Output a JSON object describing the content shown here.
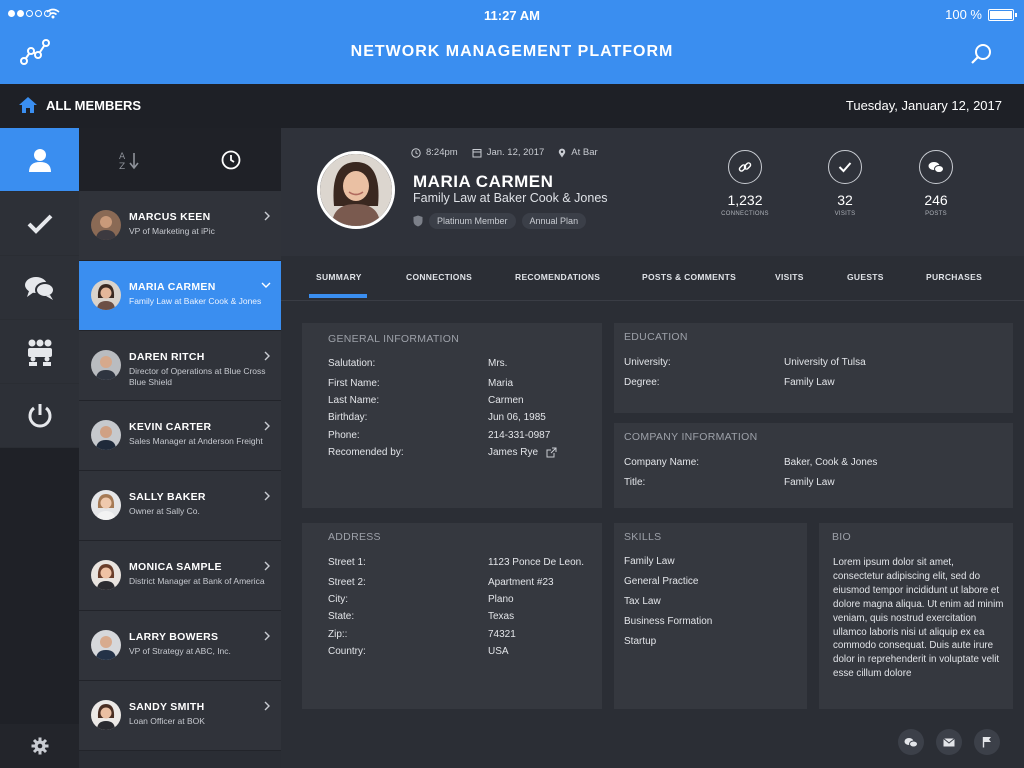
{
  "status": {
    "time": "11:27 AM",
    "battery": "100 %"
  },
  "header": {
    "title": "NETWORK MANAGEMENT PLATFORM"
  },
  "subbar": {
    "home_label": "ALL MEMBERS",
    "date": "Tuesday,  January 12, 2017"
  },
  "members": [
    {
      "name": "MARCUS KEEN",
      "role": "VP of Marketing at iPic"
    },
    {
      "name": "MARIA CARMEN",
      "role": "Family Law at Baker Cook & Jones"
    },
    {
      "name": "DAREN RITCH",
      "role": "Director of Operations at Blue Cross Blue Shield"
    },
    {
      "name": "KEVIN CARTER",
      "role": "Sales Manager at Anderson Freight"
    },
    {
      "name": "SALLY BAKER",
      "role": "Owner at Sally Co."
    },
    {
      "name": "MONICA SAMPLE",
      "role": "District Manager at Bank of America"
    },
    {
      "name": "LARRY BOWERS",
      "role": "VP of Strategy at ABC, Inc."
    },
    {
      "name": "SANDY SMITH",
      "role": "Loan Officer at BOK"
    }
  ],
  "profile": {
    "time": "8:24pm",
    "date": "Jan. 12, 2017",
    "location": "At Bar",
    "name": "MARIA CARMEN",
    "title": "Family Law at Baker Cook & Jones",
    "badges": [
      "Platinum Member",
      "Annual Plan"
    ],
    "stats": [
      {
        "value": "1,232",
        "label": "CONNECTIONS"
      },
      {
        "value": "32",
        "label": "VISITS"
      },
      {
        "value": "246",
        "label": "POSTS"
      }
    ]
  },
  "tabs": [
    "SUMMARY",
    "CONNECTIONS",
    "RECOMENDATIONS",
    "POSTS & COMMENTS",
    "VISITS",
    "GUESTS",
    "PURCHASES"
  ],
  "general": {
    "header": "GENERAL INFORMATION",
    "rows": [
      {
        "label": "Salutation:",
        "value": "Mrs."
      },
      {
        "label": "First Name:",
        "value": "Maria"
      },
      {
        "label": "Last Name:",
        "value": "Carmen"
      },
      {
        "label": "Birthday:",
        "value": "Jun 06, 1985"
      },
      {
        "label": "Phone:",
        "value": "214-331-0987"
      },
      {
        "label": "Recomended by:",
        "value": "James Rye"
      }
    ]
  },
  "education": {
    "header": "EDUCATION",
    "rows": [
      {
        "label": "University:",
        "value": "University of Tulsa"
      },
      {
        "label": "Degree:",
        "value": "Family Law"
      }
    ]
  },
  "company": {
    "header": "COMPANY INFORMATION",
    "rows": [
      {
        "label": "Company Name:",
        "value": "Baker, Cook & Jones"
      },
      {
        "label": "Title:",
        "value": "Family Law"
      }
    ]
  },
  "address": {
    "header": "ADDRESS",
    "rows": [
      {
        "label": "Street 1:",
        "value": "1123 Ponce De Leon."
      },
      {
        "label": "Street 2:",
        "value": "Apartment #23"
      },
      {
        "label": "City:",
        "value": "Plano"
      },
      {
        "label": "State:",
        "value": "Texas"
      },
      {
        "label": "Zip::",
        "value": "74321"
      },
      {
        "label": "Country:",
        "value": "USA"
      }
    ]
  },
  "skills": {
    "header": "SKILLS",
    "items": [
      "Family Law",
      "General Practice",
      "Tax Law",
      "Business Formation",
      "Startup"
    ]
  },
  "bio": {
    "header": "BIO",
    "text": "Lorem ipsum dolor sit amet, consectetur adipiscing elit, sed do eiusmod tempor incididunt ut labore et dolore magna aliqua. Ut enim ad minim veniam, quis nostrud exercitation ullamco laboris nisi ut aliquip ex ea commodo consequat. Duis aute irure dolor in reprehenderit in voluptate velit esse cillum dolore"
  },
  "colors": {
    "accent": "#3a8ef0",
    "rail": "#1f2127",
    "card": "#35383f"
  }
}
